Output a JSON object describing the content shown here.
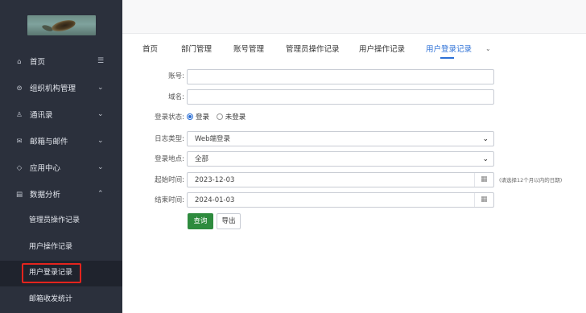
{
  "sidebar": {
    "items": [
      {
        "label": "首页",
        "icon": "home-icon",
        "arrow": "☰"
      },
      {
        "label": "组织机构管理",
        "icon": "org-icon",
        "arrow": "⌄"
      },
      {
        "label": "通讯录",
        "icon": "contacts-icon",
        "arrow": "⌄"
      },
      {
        "label": "邮箱与邮件",
        "icon": "mail-icon",
        "arrow": "⌄"
      },
      {
        "label": "应用中心",
        "icon": "app-icon",
        "arrow": "⌄"
      },
      {
        "label": "数据分析",
        "icon": "analytics-icon",
        "arrow": "⌃"
      }
    ],
    "sub_items": [
      {
        "label": "管理员操作记录"
      },
      {
        "label": "用户操作记录"
      },
      {
        "label": "用户登录记录"
      },
      {
        "label": "邮箱收发统计"
      }
    ]
  },
  "tabs": [
    {
      "label": "首页"
    },
    {
      "label": "部门管理"
    },
    {
      "label": "账号管理"
    },
    {
      "label": "管理员操作记录"
    },
    {
      "label": "用户操作记录"
    },
    {
      "label": "用户登录记录"
    }
  ],
  "tab_more": "⌄",
  "form": {
    "account_label": "账号:",
    "account_value": "",
    "domain_label": "域名:",
    "domain_value": "",
    "status_label": "登录状态:",
    "status_options": [
      "登录",
      "未登录"
    ],
    "status_selected": "登录",
    "logtype_label": "日志类型:",
    "logtype_value": "Web端登录",
    "location_label": "登录地点:",
    "location_value": "全部",
    "start_label": "起始时间:",
    "start_value": "2023-12-03",
    "end_label": "结束时间:",
    "end_value": "2024-01-03",
    "hint": "(请选择12个月以内的日期)",
    "query_button": "查询",
    "export_button": "导出"
  },
  "colors": {
    "sidebar_bg": "#2b303c",
    "accent": "#2b6fd6",
    "query_btn": "#2e8b3e",
    "highlight": "#e3241d"
  }
}
